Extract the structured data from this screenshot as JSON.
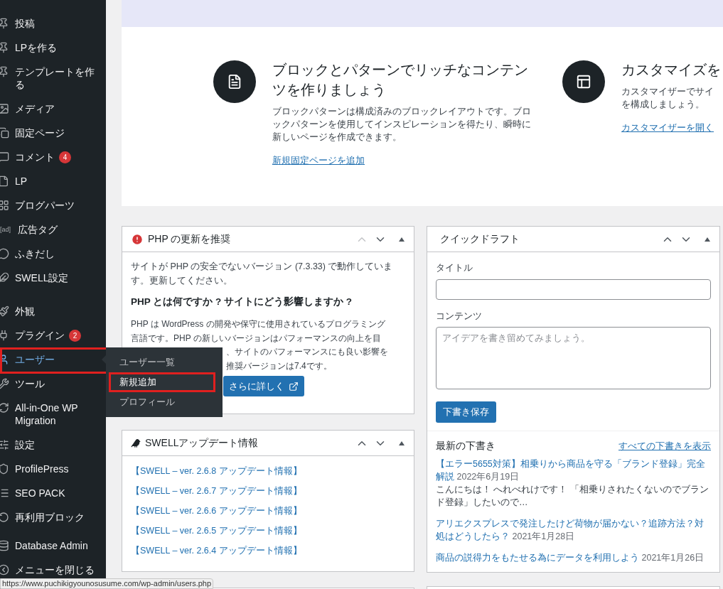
{
  "sidebar": {
    "groups": [
      {
        "items": [
          {
            "label": "投稿",
            "selected": false
          },
          {
            "label": "LPを作る",
            "selected": false
          },
          {
            "label": "テンプレートを作る",
            "selected": false
          },
          {
            "label": "メディア",
            "selected": false
          },
          {
            "label": "固定ページ",
            "selected": false
          },
          {
            "label": "コメント",
            "selected": false,
            "badge": "4"
          },
          {
            "label": "LP",
            "selected": false
          },
          {
            "label": "ブログパーツ",
            "selected": false
          },
          {
            "label": "広告タグ",
            "selected": false,
            "icon_text": "[ad]"
          },
          {
            "label": "ふきだし",
            "selected": false
          },
          {
            "label": "SWELL設定",
            "selected": false
          }
        ]
      },
      {
        "items": [
          {
            "label": "外観",
            "selected": false
          },
          {
            "label": "プラグイン",
            "selected": false,
            "badge": "2"
          },
          {
            "label": "ユーザー",
            "selected": true,
            "annotated": true,
            "flyout": [
              {
                "label": "ユーザー一覧",
                "selected": false,
                "annotated": false
              },
              {
                "label": "新規追加",
                "selected": true,
                "annotated": true
              },
              {
                "label": "プロフィール",
                "selected": false,
                "annotated": false
              }
            ]
          },
          {
            "label": "ツール",
            "selected": false
          },
          {
            "label": "All-in-One WP Migration",
            "selected": false
          },
          {
            "label": "設定",
            "selected": false
          },
          {
            "label": "ProfilePress",
            "selected": false
          },
          {
            "label": "SEO PACK",
            "selected": false
          },
          {
            "label": "再利用ブロック",
            "selected": false
          }
        ]
      },
      {
        "items": [
          {
            "label": "Database Admin",
            "selected": false
          },
          {
            "label": "メニューを閉じる",
            "selected": false
          }
        ]
      }
    ]
  },
  "welcome": {
    "columns": [
      {
        "title": "ブロックとパターンでリッチなコンテンツを作りましょう",
        "lines": [
          "ブロックパターンは構成済みのブロックレイアウトです。ブロックパターンを使用してインスピレーションを得たり、瞬時に新しいページを作成できます。"
        ],
        "link": "新規固定ページを追加"
      },
      {
        "title": "カスタマイズを",
        "lines": [
          "カスタマイザーでサイ",
          "を構成しましょう。"
        ],
        "link": "カスタマイザーを開く"
      }
    ]
  },
  "php_panel": {
    "title": "PHP の更新を推奨",
    "move_up_disabled": true,
    "message": "サイトが PHP の安全でないバージョン (7.3.33) で動作しています。更新してください。",
    "heading": "PHP とは何ですか ? サイトにどう影響しますか ?",
    "info_lines": [
      "PHP は WordPress の開発や保守に使用されているプログラミング",
      "言語です。PHP の新しいバージョンはパフォーマンスの向上を目",
      "、サイトのパフォーマンスにも良い影響を",
      "推奨バージョンは7.4です。"
    ],
    "button": "さらに詳しく"
  },
  "swell_panel": {
    "title": "SWELLアップデート情報",
    "move_up_disabled": false,
    "links": [
      "【SWELL – ver. 2.6.8 アップデート情報】",
      "【SWELL – ver. 2.6.7 アップデート情報】",
      "【SWELL – ver. 2.6.6 アップデート情報】",
      "【SWELL – ver. 2.6.5 アップデート情報】",
      "【SWELL – ver. 2.6.4 アップデート情報】"
    ]
  },
  "quick_draft": {
    "title": "クイックドラフト",
    "move_up_disabled": false,
    "title_label": "タイトル",
    "content_label": "コンテンツ",
    "content_placeholder": "アイデアを書き留めてみましょう。",
    "save_button": "下書き保存",
    "recent_heading": "最新の下書き",
    "view_all": "すべての下書きを表示",
    "drafts": [
      {
        "title": "【エラー5655対策】相乗りから商品を守る「ブランド登録」完全解説",
        "date": "2022年6月19日",
        "excerpt": "こんにちは！ へれべれけです！ 「相乗りされたくないのでブランド登録」したいので…"
      },
      {
        "title": "アリエクスプレスで発注したけど荷物が届かない？追跡方法？対処はどうしたら？",
        "date": "2021年1月28日"
      },
      {
        "title": "商品の説得力をもたせる為にデータを利用しよう",
        "date": "2021年1月26日"
      }
    ]
  },
  "status_url": "https://www.puchikigyounosusume.com/wp-admin/users.php"
}
